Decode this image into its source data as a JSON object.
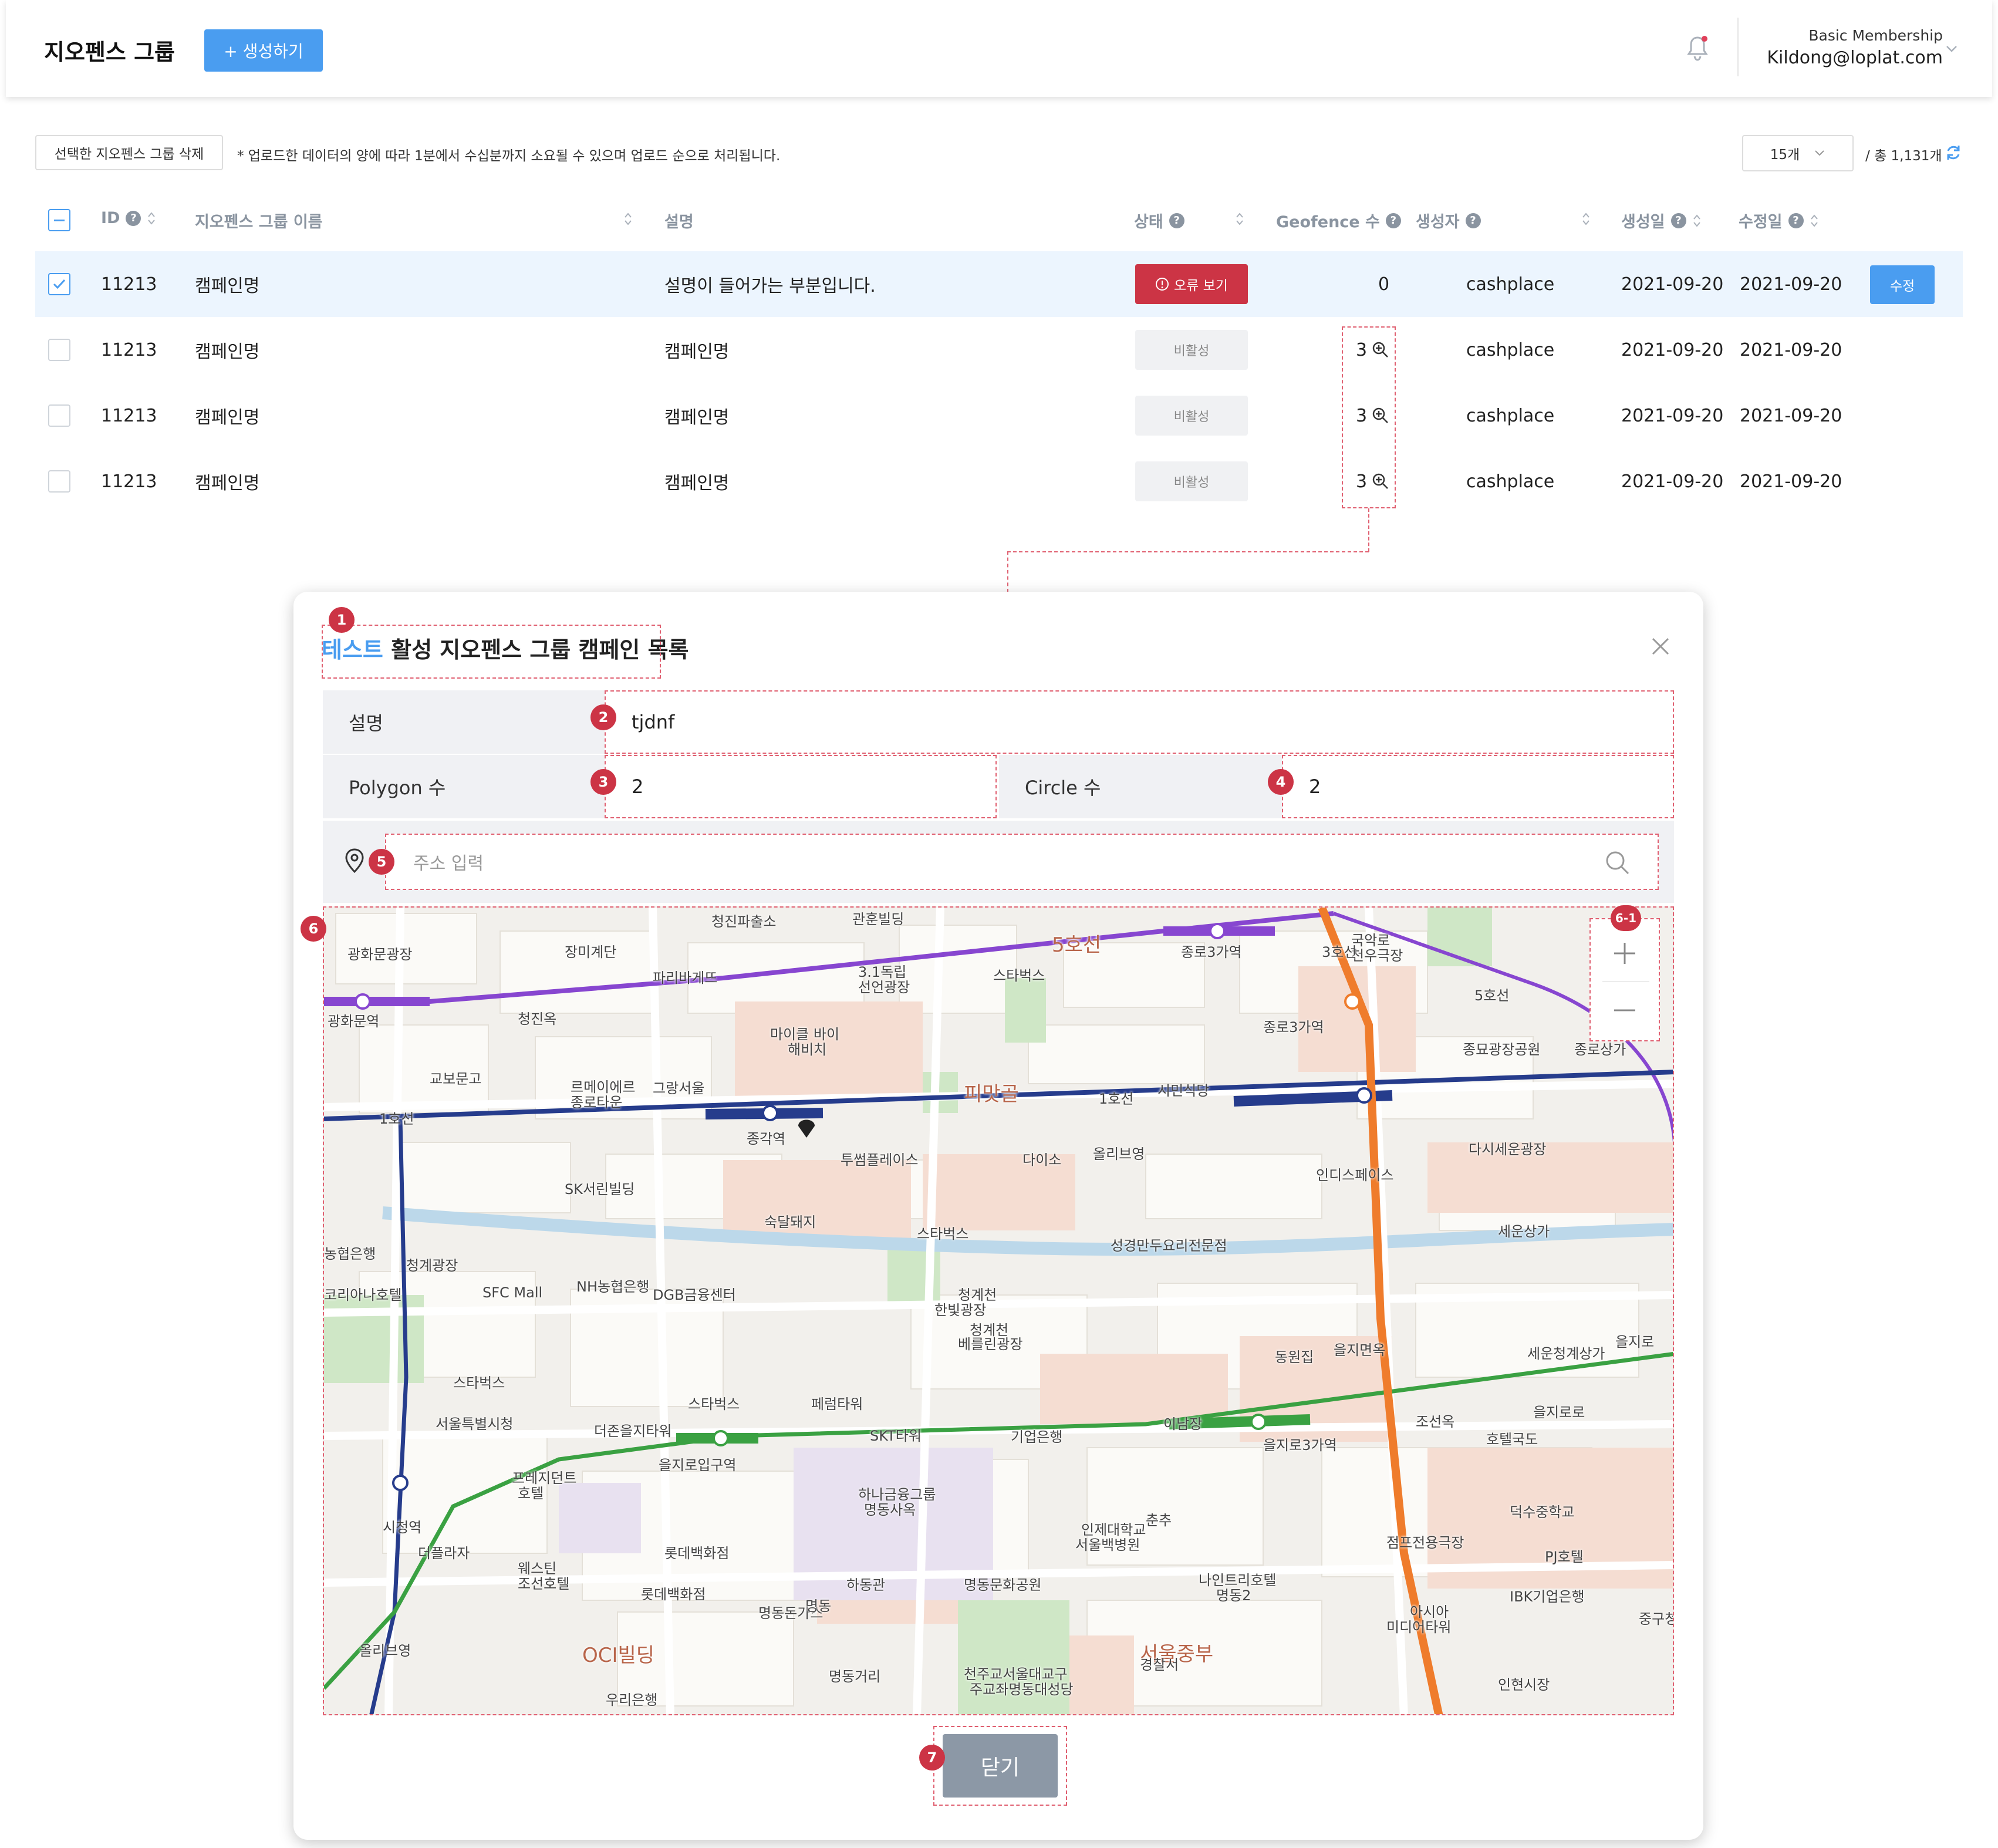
{
  "header": {
    "title": "지오펜스 그룹",
    "create_label": "+ 생성하기",
    "membership": "Basic Membership",
    "account": "Kildong@loplat.com"
  },
  "toolbar": {
    "delete_label": "선택한 지오펜스 그룹 삭제",
    "notice": "* 업로드한 데이터의 양에 따라 1분에서 수십분까지 소요될 수 있으며 업로드 순으로 처리됩니다.",
    "per_page": "15개",
    "total": "/ 총 1,131개"
  },
  "table": {
    "headers": {
      "id": "ID",
      "name": "지오펜스 그룹 이름",
      "desc": "설명",
      "status": "상태",
      "geofence": "Geofence 수",
      "creator": "생성자",
      "created": "생성일",
      "updated": "수정일"
    },
    "rows": [
      {
        "id": "11213",
        "name": "캠페인명",
        "desc": "설명이 들어가는 부분입니다.",
        "status": "오류 보기",
        "geofence": "0",
        "creator": "cashplace",
        "created": "2021-09-20",
        "updated": "2021-09-20",
        "action": "수정"
      },
      {
        "id": "11213",
        "name": "캠페인명",
        "desc": "캠페인명",
        "status": "비활성",
        "geofence": "3",
        "creator": "cashplace",
        "created": "2021-09-20",
        "updated": "2021-09-20"
      },
      {
        "id": "11213",
        "name": "캠페인명",
        "desc": "캠페인명",
        "status": "비활성",
        "geofence": "3",
        "creator": "cashplace",
        "created": "2021-09-20",
        "updated": "2021-09-20"
      },
      {
        "id": "11213",
        "name": "캠페인명",
        "desc": "캠페인명",
        "status": "비활성",
        "geofence": "3",
        "creator": "cashplace",
        "created": "2021-09-20",
        "updated": "2021-09-20"
      }
    ]
  },
  "modal": {
    "title_accent": "테스트",
    "title_rest": " 활성 지오펜스 그룹 캠페인 목록",
    "desc_label": "설명",
    "desc_value": "tjdnf",
    "polygon_label": "Polygon 수",
    "polygon_value": "2",
    "circle_label": "Circle 수",
    "circle_value": "2",
    "address_placeholder": "주소 입력",
    "close_label": "닫기",
    "badges": {
      "b1": "1",
      "b2": "2",
      "b3": "3",
      "b4": "4",
      "b5": "5",
      "b6": "6",
      "b61": "6-1",
      "b7": "7"
    }
  },
  "map": {
    "labels": [
      "청진파출소",
      "관훈빌딩",
      "광화문광장",
      "장미계단",
      "파리바게뜨",
      "3.1독립",
      "선언광장",
      "스타벅스",
      "종로3가역",
      "국악로",
      "천우극장",
      "광화문역",
      "청진옥",
      "마이클 바이",
      "해비치",
      "종로3가역",
      "종묘광장공원",
      "종로상가",
      "교보문고",
      "르메이에르",
      "종로타운",
      "그랑서울",
      "피맛골",
      "시민식당",
      "종각역",
      "투썸플레이스",
      "다이소",
      "올리브영",
      "인디스페이스",
      "다시세운광장",
      "SK서린빌딩",
      "숙달돼지",
      "스타벅스",
      "성경만두요리전문점",
      "세운상가",
      "농협은행",
      "청계광장",
      "NH농협은행",
      "코리아나호텔",
      "SFC Mall",
      "DGB금융센터",
      "청계천",
      "한빛광장",
      "청계천",
      "베를린광장",
      "을지면옥",
      "세운청계상가",
      "동원집",
      "스타벅스",
      "스타벅스",
      "페럼타워",
      "서울특별시청",
      "더존을지타워",
      "SKT타워",
      "기업은행",
      "이남장",
      "을지로3가역",
      "조선옥",
      "을지로입구역",
      "을지로로",
      "호텔국도",
      "프레지던트",
      "호텔",
      "하나금융그룹",
      "명동사옥",
      "인제대학교",
      "서울백병원",
      "춘추",
      "점프전용극장",
      "덕수중학교",
      "시청역",
      "더플라자",
      "롯데백화점",
      "웨스틴",
      "조선호텔",
      "롯데백화점",
      "하동관",
      "명동문화공원",
      "나인트리호텔",
      "명동2",
      "PJ호텔",
      "IBK기업은행",
      "명동돈가스",
      "명동",
      "아시아",
      "미디어타워",
      "중구청",
      "올리브영",
      "OCI빌딩",
      "서울중부",
      "경찰서",
      "명동거리",
      "천주교서울대교구",
      "주교좌명동대성당",
      "우리은행",
      "인현시장",
      "을지로",
      "5호선",
      "1호선",
      "3호선",
      "1호선",
      "5호선"
    ]
  },
  "colors": {
    "primary": "#4a9df0",
    "danger": "#cc3445",
    "line1": "#263c8c",
    "line2": "#3aa142",
    "line3": "#ef7c2c",
    "line5": "#8746d0"
  }
}
